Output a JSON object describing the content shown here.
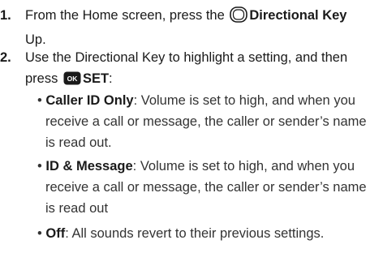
{
  "steps": [
    {
      "number": "1.",
      "line1_pre": "From the Home screen, press the",
      "line1_key": "Directional Key",
      "line2": "Up.",
      "icon": "directional-key-icon"
    },
    {
      "number": "2.",
      "line1": "Use the Directional Key to highlight a setting, and then",
      "line2_pre": "press",
      "ok_label": "OK",
      "line2_key": "SET",
      "line2_post": ":",
      "icon": "ok-key-icon"
    }
  ],
  "options": [
    {
      "term": "Caller ID Only",
      "line1_rest": ": Volume is set to high, and when you",
      "line2": "receive a call or message, the caller or sender’s name",
      "line3": "is read out."
    },
    {
      "term": "ID & Message",
      "line1_rest": ": Volume is set to high, and when you",
      "line2": "receive a call or message, the caller or sender’s name",
      "line3": "is read out"
    },
    {
      "term": "Off",
      "line1_rest": ": All sounds revert to their previous settings.",
      "line2": "",
      "line3": ""
    }
  ],
  "bullet_glyph": "•",
  "colors": {
    "ok_key_bg": "#1a1a1a",
    "ok_key_text": "#ffffff",
    "text": "#1a1a1a"
  }
}
